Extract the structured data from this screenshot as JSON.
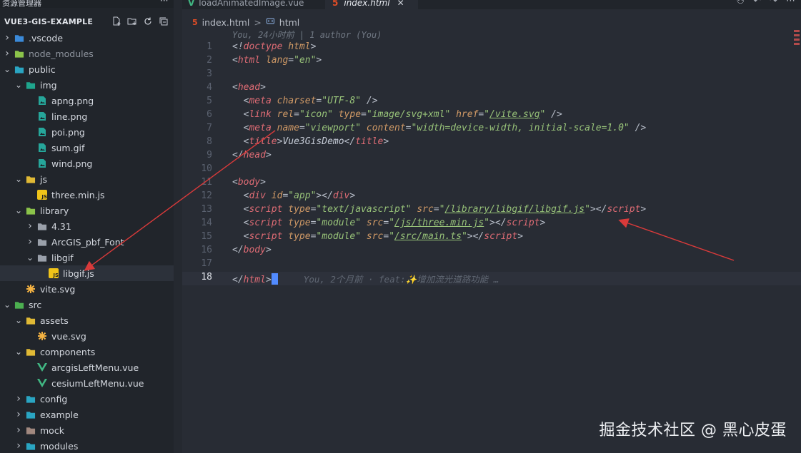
{
  "sidebar": {
    "title": "资源管理器",
    "more": "···",
    "project_name": "VUE3-GIS-EXAMPLE",
    "actions": [
      "new-file-icon",
      "new-folder-icon",
      "refresh-icon",
      "collapse-all-icon"
    ],
    "items": [
      {
        "label": ".vscode",
        "depth": 0,
        "kind": "folder",
        "open": false,
        "color": "#3b8ad9"
      },
      {
        "label": "node_modules",
        "depth": 0,
        "kind": "folder",
        "open": false,
        "color": "#8bc34a",
        "muted": true
      },
      {
        "label": "public",
        "depth": 0,
        "kind": "folder",
        "open": true,
        "color": "#2aa5c2"
      },
      {
        "label": "img",
        "depth": 1,
        "kind": "folder",
        "open": true,
        "color": "#1fa58d"
      },
      {
        "label": "apng.png",
        "depth": 2,
        "kind": "image",
        "color": "#26a69a"
      },
      {
        "label": "line.png",
        "depth": 2,
        "kind": "image",
        "color": "#26a69a"
      },
      {
        "label": "poi.png",
        "depth": 2,
        "kind": "image",
        "color": "#26a69a"
      },
      {
        "label": "sum.gif",
        "depth": 2,
        "kind": "image",
        "color": "#26a69a"
      },
      {
        "label": "wind.png",
        "depth": 2,
        "kind": "image",
        "color": "#26a69a"
      },
      {
        "label": "js",
        "depth": 1,
        "kind": "folder",
        "open": true,
        "color": "#e0b935"
      },
      {
        "label": "three.min.js",
        "depth": 2,
        "kind": "js",
        "color": "#f0c419"
      },
      {
        "label": "library",
        "depth": 1,
        "kind": "folder",
        "open": true,
        "color": "#8bc34a"
      },
      {
        "label": "4.31",
        "depth": 2,
        "kind": "folder",
        "open": false,
        "color": "#9aa0aa"
      },
      {
        "label": "ArcGIS_pbf_Font",
        "depth": 2,
        "kind": "folder",
        "open": false,
        "color": "#9aa0aa"
      },
      {
        "label": "libgif",
        "depth": 2,
        "kind": "folder",
        "open": true,
        "color": "#9aa0aa"
      },
      {
        "label": "libgif.js",
        "depth": 3,
        "kind": "js",
        "color": "#f0c419",
        "selected": true
      },
      {
        "label": "vite.svg",
        "depth": 1,
        "kind": "svg",
        "color": "#f5b342"
      },
      {
        "label": "src",
        "depth": 0,
        "kind": "folder",
        "open": true,
        "color": "#4caf50"
      },
      {
        "label": "assets",
        "depth": 1,
        "kind": "folder",
        "open": true,
        "color": "#e0b935"
      },
      {
        "label": "vue.svg",
        "depth": 2,
        "kind": "svg",
        "color": "#f5b342"
      },
      {
        "label": "components",
        "depth": 1,
        "kind": "folder",
        "open": true,
        "color": "#e0b935"
      },
      {
        "label": "arcgisLeftMenu.vue",
        "depth": 2,
        "kind": "vue",
        "color": "#41b883"
      },
      {
        "label": "cesiumLeftMenu.vue",
        "depth": 2,
        "kind": "vue",
        "color": "#41b883"
      },
      {
        "label": "config",
        "depth": 1,
        "kind": "folder",
        "open": false,
        "color": "#2aa5c2"
      },
      {
        "label": "example",
        "depth": 1,
        "kind": "folder",
        "open": false,
        "color": "#2aa5c2"
      },
      {
        "label": "mock",
        "depth": 1,
        "kind": "folder",
        "open": false,
        "color": "#a1887f"
      },
      {
        "label": "modules",
        "depth": 1,
        "kind": "folder",
        "open": false,
        "color": "#2aa5c2"
      }
    ]
  },
  "tabs": [
    {
      "label": "loadAnimatedImage.vue",
      "icon": "vue-file-icon",
      "active": false
    },
    {
      "label": "index.html",
      "icon": "html-file-icon",
      "active": true
    }
  ],
  "tab_actions": [
    "compare-icon",
    "go-back-icon",
    "go-forward-icon",
    "more-icon"
  ],
  "breadcrumb": {
    "file": "index.html",
    "sep": ">",
    "symbol": "html"
  },
  "blame_top": "You, 24小时前 | 1 author (You)",
  "blame_inline": "You, 2个月前 · feat:✨增加流光道路功能 …",
  "current_line": 18,
  "code_lines": [
    [
      {
        "t": "<!",
        "c": "p"
      },
      {
        "t": "doctype",
        "c": "tag"
      },
      {
        "t": " ",
        "c": "p"
      },
      {
        "t": "html",
        "c": "attr"
      },
      {
        "t": ">",
        "c": "p"
      }
    ],
    [
      {
        "t": "<",
        "c": "p"
      },
      {
        "t": "html",
        "c": "tag"
      },
      {
        "t": " ",
        "c": "p"
      },
      {
        "t": "lang",
        "c": "attr"
      },
      {
        "t": "=",
        "c": "p"
      },
      {
        "t": "\"en\"",
        "c": "str"
      },
      {
        "t": ">",
        "c": "p"
      }
    ],
    [],
    [
      {
        "t": "<",
        "c": "p"
      },
      {
        "t": "head",
        "c": "tag"
      },
      {
        "t": ">",
        "c": "p"
      }
    ],
    [
      {
        "t": "  <",
        "c": "p"
      },
      {
        "t": "meta",
        "c": "tag"
      },
      {
        "t": " ",
        "c": "p"
      },
      {
        "t": "charset",
        "c": "attr"
      },
      {
        "t": "=",
        "c": "p"
      },
      {
        "t": "\"UTF-8\"",
        "c": "str"
      },
      {
        "t": " />",
        "c": "p"
      }
    ],
    [
      {
        "t": "  <",
        "c": "p"
      },
      {
        "t": "link",
        "c": "tag"
      },
      {
        "t": " ",
        "c": "p"
      },
      {
        "t": "rel",
        "c": "attr"
      },
      {
        "t": "=",
        "c": "p"
      },
      {
        "t": "\"icon\"",
        "c": "str"
      },
      {
        "t": " ",
        "c": "p"
      },
      {
        "t": "type",
        "c": "attr"
      },
      {
        "t": "=",
        "c": "p"
      },
      {
        "t": "\"image/svg+xml\"",
        "c": "str"
      },
      {
        "t": " ",
        "c": "p"
      },
      {
        "t": "href",
        "c": "attr"
      },
      {
        "t": "=",
        "c": "p"
      },
      {
        "t": "\"",
        "c": "str"
      },
      {
        "t": "/vite.svg",
        "c": "link"
      },
      {
        "t": "\"",
        "c": "str"
      },
      {
        "t": " />",
        "c": "p"
      }
    ],
    [
      {
        "t": "  <",
        "c": "p"
      },
      {
        "t": "meta",
        "c": "tag"
      },
      {
        "t": " ",
        "c": "p"
      },
      {
        "t": "name",
        "c": "attr"
      },
      {
        "t": "=",
        "c": "p"
      },
      {
        "t": "\"viewport\"",
        "c": "str"
      },
      {
        "t": " ",
        "c": "p"
      },
      {
        "t": "content",
        "c": "attr"
      },
      {
        "t": "=",
        "c": "p"
      },
      {
        "t": "\"width=device-width, initial-scale=1.0\"",
        "c": "str"
      },
      {
        "t": " />",
        "c": "p"
      }
    ],
    [
      {
        "t": "  <",
        "c": "p"
      },
      {
        "t": "title",
        "c": "tag"
      },
      {
        "t": ">",
        "c": "p"
      },
      {
        "t": "Vue3GisDemo",
        "c": "text"
      },
      {
        "t": "</",
        "c": "p"
      },
      {
        "t": "title",
        "c": "tag"
      },
      {
        "t": ">",
        "c": "p"
      }
    ],
    [
      {
        "t": "</",
        "c": "p"
      },
      {
        "t": "head",
        "c": "tag"
      },
      {
        "t": ">",
        "c": "p"
      }
    ],
    [],
    [
      {
        "t": "<",
        "c": "p"
      },
      {
        "t": "body",
        "c": "tag"
      },
      {
        "t": ">",
        "c": "p"
      }
    ],
    [
      {
        "t": "  <",
        "c": "p"
      },
      {
        "t": "div",
        "c": "tag"
      },
      {
        "t": " ",
        "c": "p"
      },
      {
        "t": "id",
        "c": "attr"
      },
      {
        "t": "=",
        "c": "p"
      },
      {
        "t": "\"app\"",
        "c": "str"
      },
      {
        "t": "></",
        "c": "p"
      },
      {
        "t": "div",
        "c": "tag"
      },
      {
        "t": ">",
        "c": "p"
      }
    ],
    [
      {
        "t": "  <",
        "c": "p"
      },
      {
        "t": "script",
        "c": "tag"
      },
      {
        "t": " ",
        "c": "p"
      },
      {
        "t": "type",
        "c": "attr"
      },
      {
        "t": "=",
        "c": "p"
      },
      {
        "t": "\"text/javascript\"",
        "c": "str"
      },
      {
        "t": " ",
        "c": "p"
      },
      {
        "t": "src",
        "c": "attr"
      },
      {
        "t": "=",
        "c": "p"
      },
      {
        "t": "\"",
        "c": "str"
      },
      {
        "t": "/library/libgif/libgif.js",
        "c": "link"
      },
      {
        "t": "\"",
        "c": "str"
      },
      {
        "t": "></",
        "c": "p"
      },
      {
        "t": "script",
        "c": "tag"
      },
      {
        "t": ">",
        "c": "p"
      }
    ],
    [
      {
        "t": "  <",
        "c": "p"
      },
      {
        "t": "script",
        "c": "tag"
      },
      {
        "t": " ",
        "c": "p"
      },
      {
        "t": "type",
        "c": "attr"
      },
      {
        "t": "=",
        "c": "p"
      },
      {
        "t": "\"module\"",
        "c": "str"
      },
      {
        "t": " ",
        "c": "p"
      },
      {
        "t": "src",
        "c": "attr"
      },
      {
        "t": "=",
        "c": "p"
      },
      {
        "t": "\"",
        "c": "str"
      },
      {
        "t": "/js/three.min.js",
        "c": "link"
      },
      {
        "t": "\"",
        "c": "str"
      },
      {
        "t": "></",
        "c": "p"
      },
      {
        "t": "script",
        "c": "tag"
      },
      {
        "t": ">",
        "c": "p"
      }
    ],
    [
      {
        "t": "  <",
        "c": "p"
      },
      {
        "t": "script",
        "c": "tag"
      },
      {
        "t": " ",
        "c": "p"
      },
      {
        "t": "type",
        "c": "attr"
      },
      {
        "t": "=",
        "c": "p"
      },
      {
        "t": "\"module\"",
        "c": "str"
      },
      {
        "t": " ",
        "c": "p"
      },
      {
        "t": "src",
        "c": "attr"
      },
      {
        "t": "=",
        "c": "p"
      },
      {
        "t": "\"",
        "c": "str"
      },
      {
        "t": "/src/main.ts",
        "c": "link"
      },
      {
        "t": "\"",
        "c": "str"
      },
      {
        "t": "></",
        "c": "p"
      },
      {
        "t": "script",
        "c": "tag"
      },
      {
        "t": ">",
        "c": "p"
      }
    ],
    [
      {
        "t": "</",
        "c": "p"
      },
      {
        "t": "body",
        "c": "tag"
      },
      {
        "t": ">",
        "c": "p"
      }
    ],
    [],
    [
      {
        "t": "</",
        "c": "p"
      },
      {
        "t": "html",
        "c": "tag"
      },
      {
        "t": ">",
        "c": "p"
      }
    ]
  ],
  "watermark": "掘金技术社区 @ 黑心皮蛋",
  "colors": {
    "annotation_arrow": "#d93a3a",
    "selection": "#2c313a",
    "cursor": "#528bff"
  }
}
